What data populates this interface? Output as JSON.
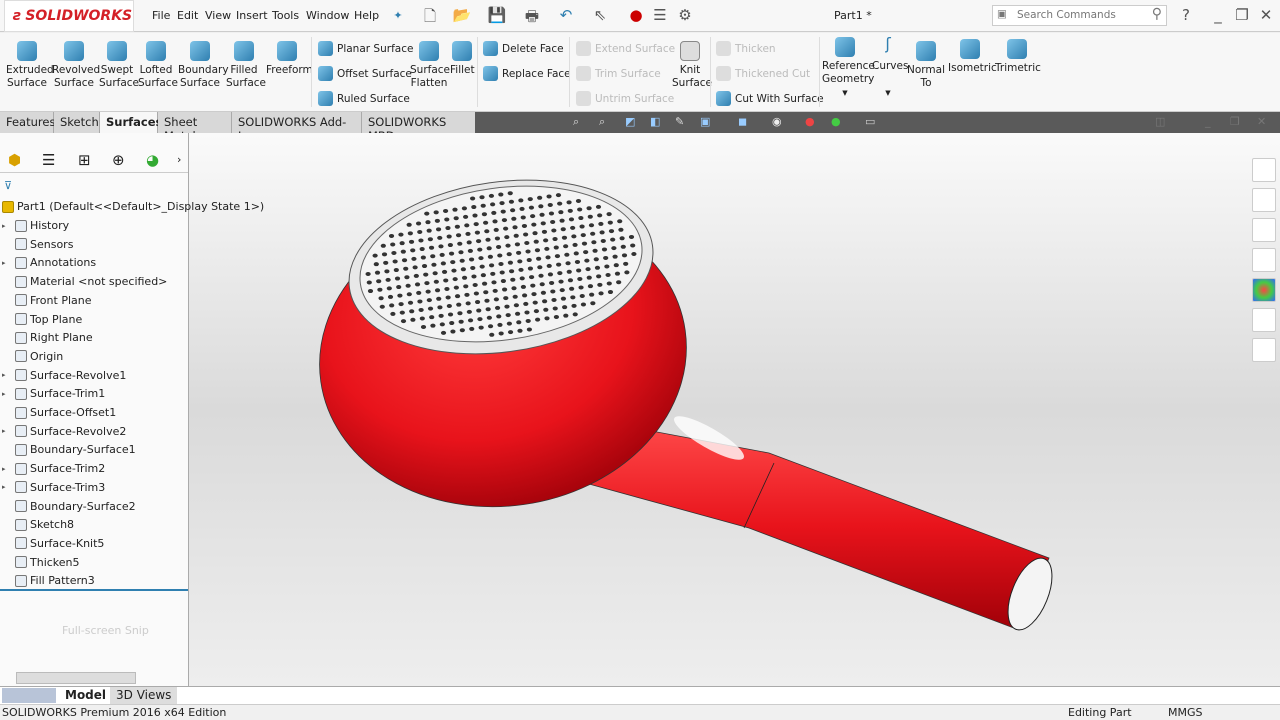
{
  "app": {
    "logo": "SOLIDWORKS",
    "title": "Part1 *"
  },
  "menu": [
    "File",
    "Edit",
    "View",
    "Insert",
    "Tools",
    "Window",
    "Help"
  ],
  "search": {
    "placeholder": "Search Commands"
  },
  "ribbon": {
    "big": [
      {
        "l1": "Extruded",
        "l2": "Surface"
      },
      {
        "l1": "Revolved",
        "l2": "Surface"
      },
      {
        "l1": "Swept",
        "l2": "Surface"
      },
      {
        "l1": "Lofted",
        "l2": "Surface"
      },
      {
        "l1": "Boundary",
        "l2": "Surface"
      },
      {
        "l1": "Filled",
        "l2": "Surface"
      },
      {
        "l1": "Freeform",
        "l2": ""
      }
    ],
    "surface_group": [
      "Planar Surface",
      "Offset Surface",
      "Ruled Surface"
    ],
    "flatten": {
      "l1": "Surface",
      "l2": "Flatten"
    },
    "fillet": "Fillet",
    "face_group": [
      "Delete Face",
      "Replace Face"
    ],
    "trim_group": [
      "Extend Surface",
      "Trim Surface",
      "Untrim Surface"
    ],
    "knit": {
      "l1": "Knit",
      "l2": "Surface"
    },
    "thicken_group": [
      "Thicken",
      "Thickened Cut",
      "Cut With Surface"
    ],
    "view_group": [
      {
        "l1": "Reference",
        "l2": "Geometry"
      },
      {
        "l1": "Curves",
        "l2": ""
      },
      {
        "l1": "Normal",
        "l2": "To"
      },
      {
        "l1": "Isometric",
        "l2": ""
      },
      {
        "l1": "Trimetric",
        "l2": ""
      }
    ]
  },
  "tabs": [
    "Features",
    "Sketch",
    "Surfaces",
    "Sheet Metal",
    "SOLIDWORKS Add-Ins",
    "SOLIDWORKS MBD"
  ],
  "active_tab": "Surfaces",
  "tree": {
    "root": "Part1  (Default<<Default>_Display State 1>)",
    "items": [
      "History",
      "Sensors",
      "Annotations",
      "Material <not specified>",
      "Front Plane",
      "Top Plane",
      "Right Plane",
      "Origin",
      "Surface-Revolve1",
      "Surface-Trim1",
      "Surface-Offset1",
      "Surface-Revolve2",
      "Boundary-Surface1",
      "Surface-Trim2",
      "Surface-Trim3",
      "Boundary-Surface2",
      "Sketch8",
      "Surface-Knit5",
      "Thicken5",
      "Fill Pattern3"
    ],
    "expandable": [
      0,
      2,
      8,
      9,
      11,
      13,
      14
    ]
  },
  "snip": "Full-screen Snip",
  "bottom_tabs": [
    "Model",
    "3D Views"
  ],
  "status": {
    "edition": "SOLIDWORKS Premium 2016 x64 Edition",
    "mode": "Editing Part",
    "units": "MMGS"
  },
  "colors": {
    "part": "#e8131b",
    "accent": "#2f7fb0"
  }
}
